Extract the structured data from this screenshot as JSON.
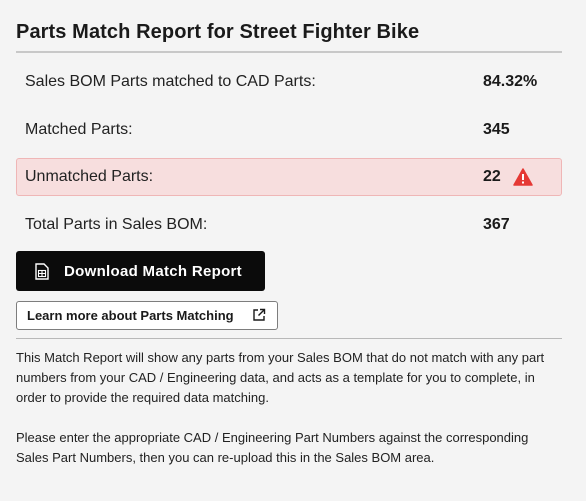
{
  "header": {
    "title": "Parts Match Report for Street Fighter Bike"
  },
  "stats": [
    {
      "label": "Sales BOM Parts matched to CAD Parts:",
      "value": "84.32%",
      "alert": false
    },
    {
      "label": "Matched Parts:",
      "value": "345",
      "alert": false
    },
    {
      "label": "Unmatched Parts:",
      "value": "22",
      "alert": true,
      "icon": "warning-triangle-icon"
    },
    {
      "label": "Total Parts in Sales BOM:",
      "value": "367",
      "alert": false
    }
  ],
  "actions": {
    "download_label": "Download Match Report",
    "download_icon": "spreadsheet-file-icon",
    "learn_more_label": "Learn more about Parts Matching",
    "learn_more_icon": "external-link-icon"
  },
  "info": {
    "paragraph1": "This Match Report will show any parts from your Sales BOM that do not match with any part numbers from your CAD / Engineering data, and acts as a template for you to complete, in order to provide the required data matching.",
    "paragraph2": "Please enter the appropriate CAD / Engineering Part Numbers against the corresponding Sales Part Numbers, then you can re-upload this in the Sales BOM area."
  },
  "colors": {
    "background": "#f4f4f4",
    "alert_background": "#f7dede",
    "alert_border": "#efb6b6",
    "warning": "#e53935",
    "primary_button": "#0b0b0b"
  }
}
